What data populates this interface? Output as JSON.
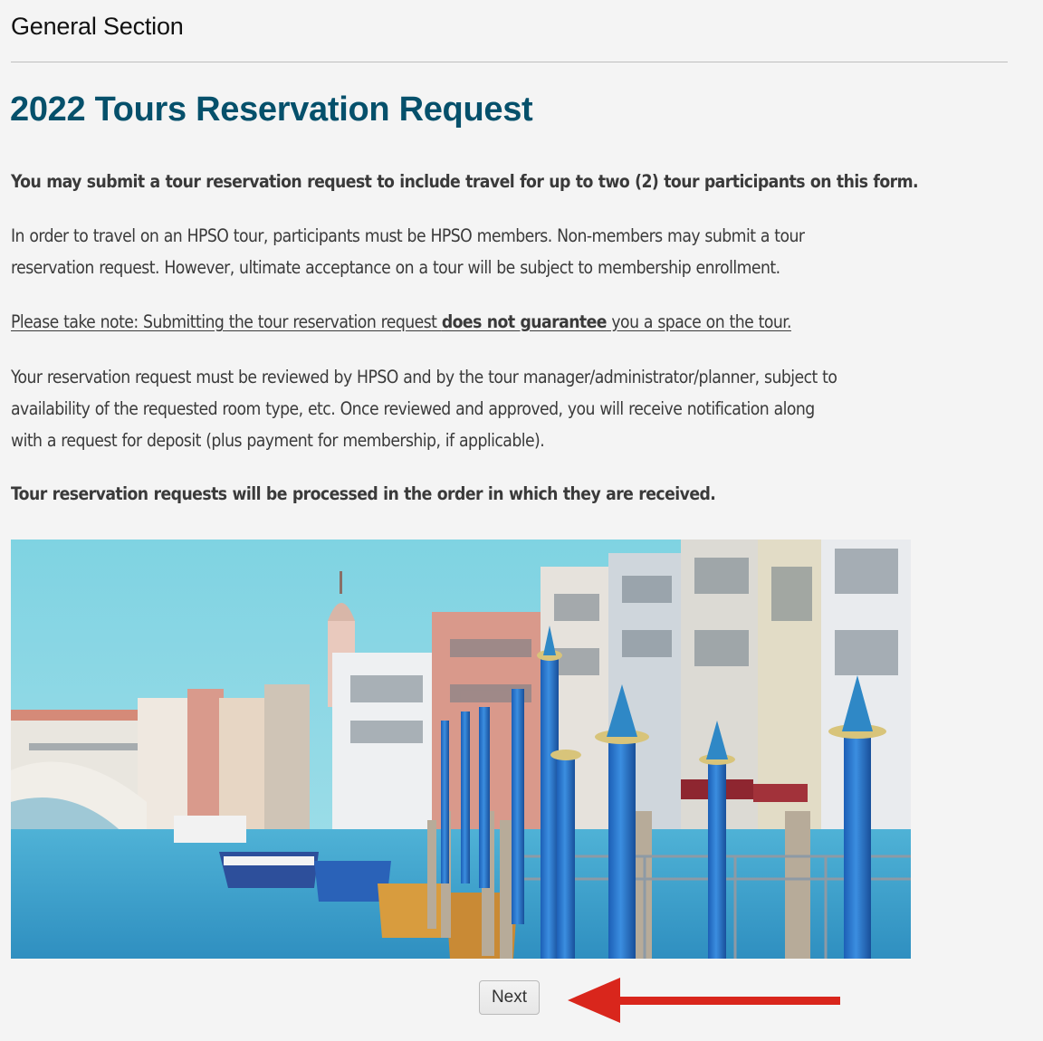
{
  "section_header": "General Section",
  "page_title": "2022 Tours Reservation Request",
  "paragraphs": {
    "intro": "You may submit a tour reservation request to include travel for up to two (2) tour participants on this form.",
    "membership_line1": "In order to travel on an HPSO tour, participants must be HPSO members.  Non-members may submit a tour",
    "membership_line2": "reservation request.  However, ultimate acceptance on a tour will be subject to membership enrollment.",
    "note_prefix": "Please take note: Submitting the tour reservation request ",
    "note_bold": "does not guarantee",
    "note_suffix": " you a space on the tour.",
    "review_line1": "Your reservation request must be reviewed by HPSO and by the tour manager/administrator/planner, subject to",
    "review_line2": "availability of the requested room type, etc.  Once reviewed and approved, you will receive notification along",
    "review_line3": "with a request for deposit (plus payment for membership, if applicable).",
    "processing": "Tour reservation requests will be processed in the order in which they are received."
  },
  "banner_image": {
    "alt": "Venice Grand Canal with Rialto Bridge and blue mooring poles"
  },
  "buttons": {
    "next_label": "Next"
  },
  "annotation": {
    "arrow_icon": "left-arrow",
    "color": "#d9261c"
  },
  "colors": {
    "title": "#05506b",
    "background": "#f4f4f4",
    "text": "#3a3a3a"
  }
}
